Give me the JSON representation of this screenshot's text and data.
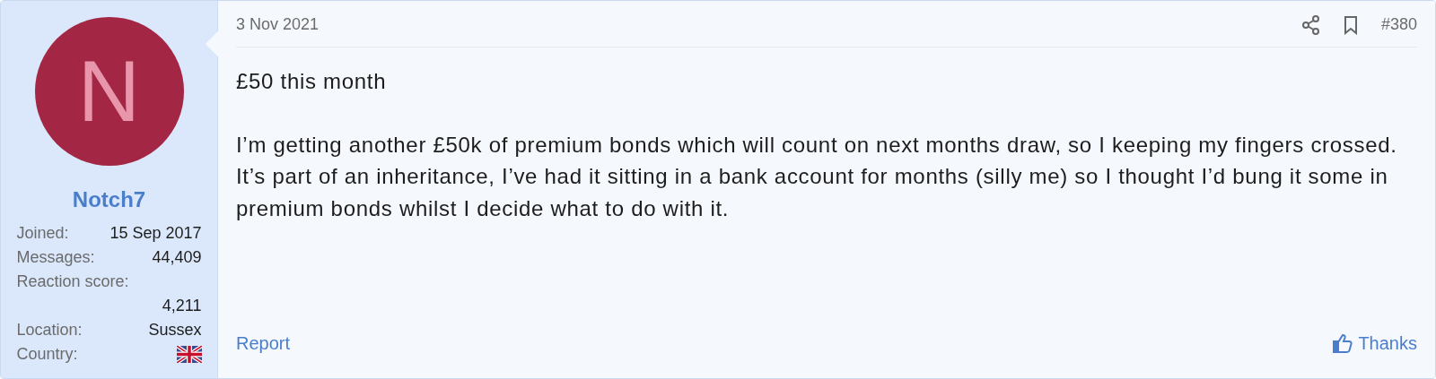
{
  "author": {
    "initial": "N",
    "name": "Notch7",
    "stats": [
      {
        "label": "Joined:",
        "value": "15 Sep 2017"
      },
      {
        "label": "Messages:",
        "value": "44,409"
      },
      {
        "label": "Reaction score:",
        "value": "4,211"
      },
      {
        "label": "Location:",
        "value": "Sussex"
      },
      {
        "label": "Country:",
        "kind": "flag"
      }
    ]
  },
  "post": {
    "date": "3 Nov 2021",
    "number": "#380",
    "paragraphs": [
      "£50 this month",
      "I’m getting another £50k of premium bonds which will count on next months draw, so I keeping my fingers crossed. It’s part of an inheritance, I’ve had it sitting in a bank account for months (silly me) so I thought I’d bung it some in premium bonds whilst I decide what to do with it."
    ],
    "report": "Report",
    "thanks": "Thanks"
  }
}
